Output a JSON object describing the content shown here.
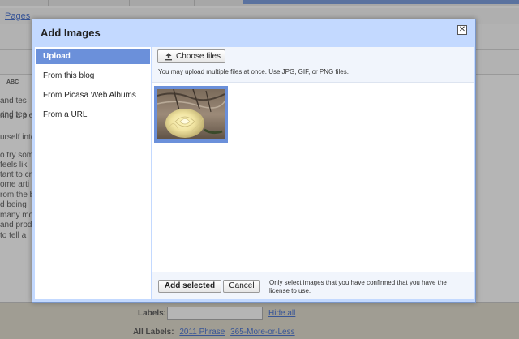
{
  "background": {
    "nav_link": "Pages",
    "abc_label": "ABC",
    "text_lines": [
      "and tes",
      "ring a pie",
      "urself into",
      "o try som",
      "feels lik",
      "tant to cr",
      "ome arti",
      "rom the b",
      "d being",
      "many mo",
      "and prod",
      "to tell a"
    ],
    "labels_label": "Labels:",
    "labels_value": "",
    "hide_all": "Hide all",
    "all_labels_label": "All Labels:",
    "all_labels": [
      "2011 Phrase",
      "365-More-or-Less"
    ]
  },
  "dialog": {
    "title": "Add Images",
    "close_glyph": "✕",
    "nav": [
      {
        "label": "Upload",
        "active": true
      },
      {
        "label": "From this blog",
        "active": false
      },
      {
        "label": "From Picasa Web Albums",
        "active": false
      },
      {
        "label": "From a URL",
        "active": false
      }
    ],
    "choose_files_label": "Choose files",
    "upload_note": "You may upload multiple files at once. Use JPG, GIF, or PNG files.",
    "thumbnail_selected": true,
    "add_selected_label": "Add selected",
    "cancel_label": "Cancel",
    "license_note": "Only select images that you have confirmed that you have the license to use."
  },
  "colors": {
    "dialog_bg": "#c3d9ff",
    "nav_active": "#6b90da",
    "link": "#1d51c7"
  }
}
